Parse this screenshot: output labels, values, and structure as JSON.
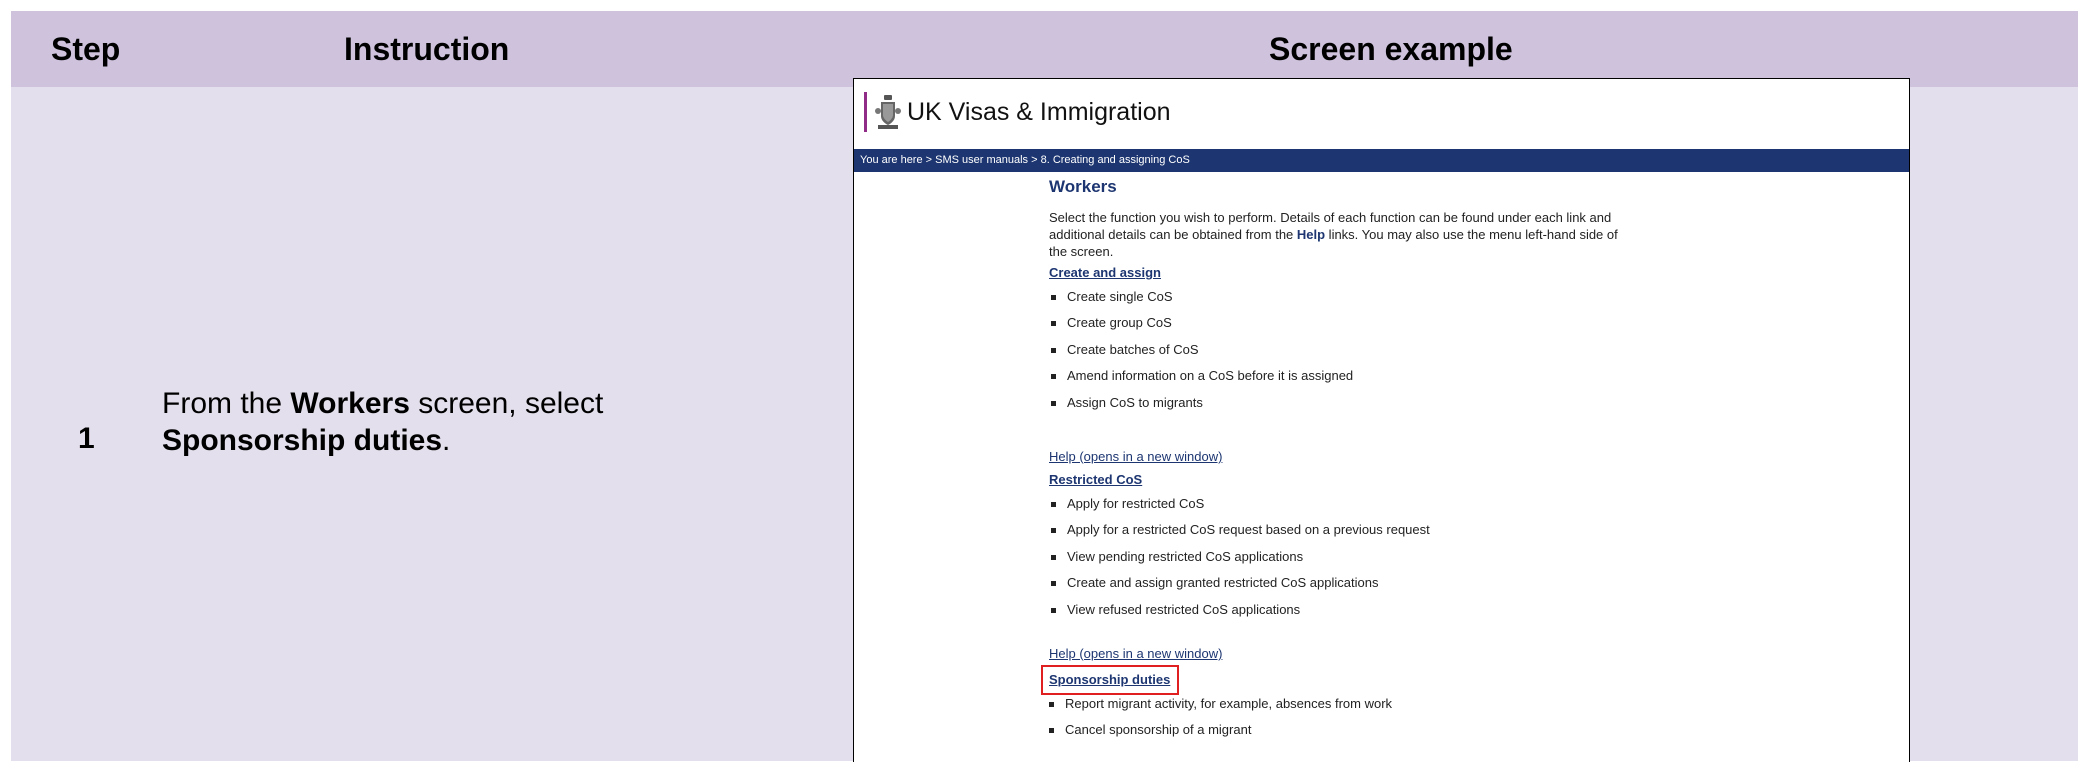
{
  "table": {
    "headers": {
      "step": "Step",
      "instruction": "Instruction",
      "screen_example": "Screen example"
    },
    "row": {
      "step": "1",
      "instruction_pre": "From the ",
      "instruction_bold1": "Workers",
      "instruction_mid": " screen, select ",
      "instruction_bold2": "Sponsorship duties",
      "instruction_post": "."
    }
  },
  "screenshot": {
    "brand": "UK Visas & Immigration",
    "breadcrumb": "You are here > SMS user manuals >  8. Creating and assigning CoS",
    "page_title": "Workers",
    "intro_pre": "Select the function you wish to perform. Details of each function can be found under each link and additional details can be obtained from the ",
    "intro_bold": "Help",
    "intro_post": " links. You may also use the menu left-hand side of the screen.",
    "sections": [
      {
        "title": "Create and assign",
        "items": [
          "Create single CoS",
          "Create group CoS",
          "Create batches of CoS",
          "Amend information on a CoS before it is assigned",
          "Assign CoS to migrants"
        ],
        "help": "Help (opens in a new window)"
      },
      {
        "title": "Restricted CoS",
        "items": [
          "Apply for restricted CoS",
          "Apply for a restricted CoS request based on a previous request",
          "View pending restricted CoS applications",
          "Create and assign granted restricted CoS applications",
          "View refused restricted CoS applications"
        ],
        "help": "Help (opens in a new window)"
      },
      {
        "title": "Sponsorship duties",
        "items": [
          "Report migrant activity, for example, absences from work",
          "Cancel sponsorship of a migrant"
        ]
      }
    ],
    "highlight_color": "#e02020"
  }
}
